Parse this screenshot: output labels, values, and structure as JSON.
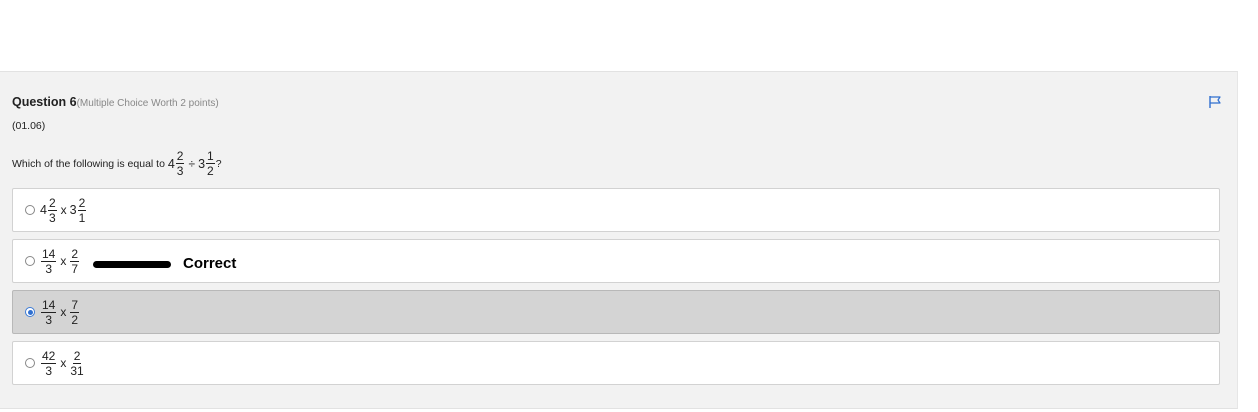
{
  "question": {
    "title": "Question 6",
    "worth": "(Multiple Choice Worth 2 points)",
    "code": "(01.06)",
    "prompt": {
      "text": "Which of the following is equal to",
      "expr": {
        "a_whole": "4",
        "a_num": "2",
        "a_den": "3",
        "op": "÷",
        "b_whole": "3",
        "b_num": "1",
        "b_den": "2",
        "end": "?"
      }
    },
    "flag_icon": "flag-icon",
    "options": [
      {
        "selected": false,
        "p1_whole": "4",
        "p1_num": "2",
        "p1_den": "3",
        "op": "x",
        "p2_whole": "3",
        "p2_num": "2",
        "p2_den": "1"
      },
      {
        "selected": false,
        "p1_num": "14",
        "p1_den": "3",
        "op": "x",
        "p2_num": "2",
        "p2_den": "7",
        "annotation": "Correct"
      },
      {
        "selected": true,
        "p1_num": "14",
        "p1_den": "3",
        "op": "x",
        "p2_num": "7",
        "p2_den": "2"
      },
      {
        "selected": false,
        "p1_num": "42",
        "p1_den": "3",
        "op": "x",
        "p2_num": "2",
        "p2_den": "31"
      }
    ]
  },
  "colors": {
    "panel_bg": "#f2f2f2",
    "selected_bg": "#d4d4d4",
    "accent": "#2f6fd0"
  }
}
